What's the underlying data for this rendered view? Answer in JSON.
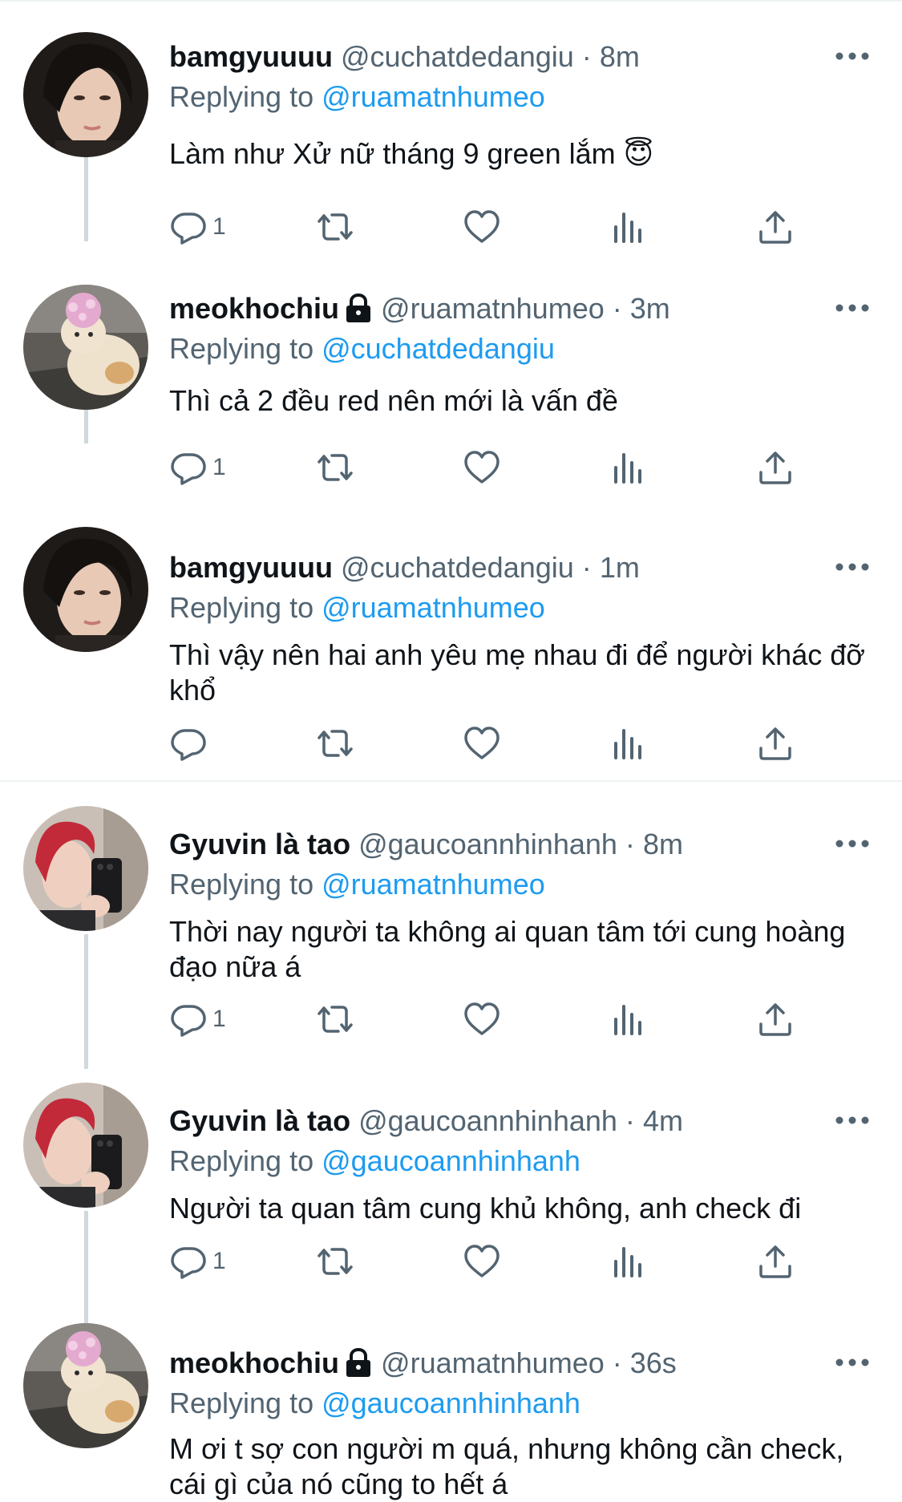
{
  "tweets": [
    {
      "name": "bamgyuuuu",
      "handle": "@cuchatdedangiu",
      "dot": "·",
      "time": "8m",
      "replying_prefix": "Replying to ",
      "replying_to": "@ruamatnhumeo",
      "text": "Làm như Xử nữ tháng 9 green lắm 😇",
      "reply_count": "1",
      "avatar": "dark-haired-boy",
      "locked": false
    },
    {
      "name": "meokhochiu",
      "handle": "@ruamatnhumeo",
      "dot": "·",
      "time": "3m",
      "replying_prefix": "Replying to ",
      "replying_to": "@cuchatdedangiu",
      "text": "Thì cả 2 đều red nên mới là vấn đề",
      "reply_count": "1",
      "avatar": "cat-with-pink-cap",
      "locked": true
    },
    {
      "name": "bamgyuuuu",
      "handle": "@cuchatdedangiu",
      "dot": "·",
      "time": "1m",
      "replying_prefix": "Replying to ",
      "replying_to": "@ruamatnhumeo",
      "text": "Thì vậy nên hai anh yêu mẹ nhau đi để người khác đỡ khổ",
      "reply_count": "",
      "avatar": "dark-haired-boy",
      "locked": false
    },
    {
      "name": "Gyuvin là tao",
      "handle": "@gaucoannhinhanh",
      "dot": "·",
      "time": "8m",
      "replying_prefix": "Replying to ",
      "replying_to": "@ruamatnhumeo",
      "text": "Thời nay người ta không ai quan tâm tới cung hoàng đạo nữa á",
      "reply_count": "1",
      "avatar": "red-haired-selfie",
      "locked": false
    },
    {
      "name": "Gyuvin là tao",
      "handle": "@gaucoannhinhanh",
      "dot": "·",
      "time": "4m",
      "replying_prefix": "Replying to ",
      "replying_to": "@gaucoannhinhanh",
      "text": "Người ta quan tâm cung khủ không, anh check đi",
      "reply_count": "1",
      "avatar": "red-haired-selfie",
      "locked": false
    },
    {
      "name": "meokhochiu",
      "handle": "@ruamatnhumeo",
      "dot": "·",
      "time": "36s",
      "replying_prefix": "Replying to ",
      "replying_to": "@gaucoannhinhanh",
      "text": "M ơi t sợ con người m quá, nhưng không cần check, cái gì của nó cũng to hết á",
      "reply_count": "",
      "avatar": "cat-with-pink-cap",
      "locked": true
    }
  ],
  "icons": {
    "reply": "reply-icon",
    "retweet": "retweet-icon",
    "like": "heart-icon",
    "views": "bar-chart-icon",
    "share": "share-icon",
    "more": "more-dots-icon",
    "lock": "lock-icon"
  },
  "colors": {
    "text": "#0f1419",
    "secondary": "#536471",
    "link": "#1d9bf0",
    "thread_line": "#cfd9de"
  }
}
